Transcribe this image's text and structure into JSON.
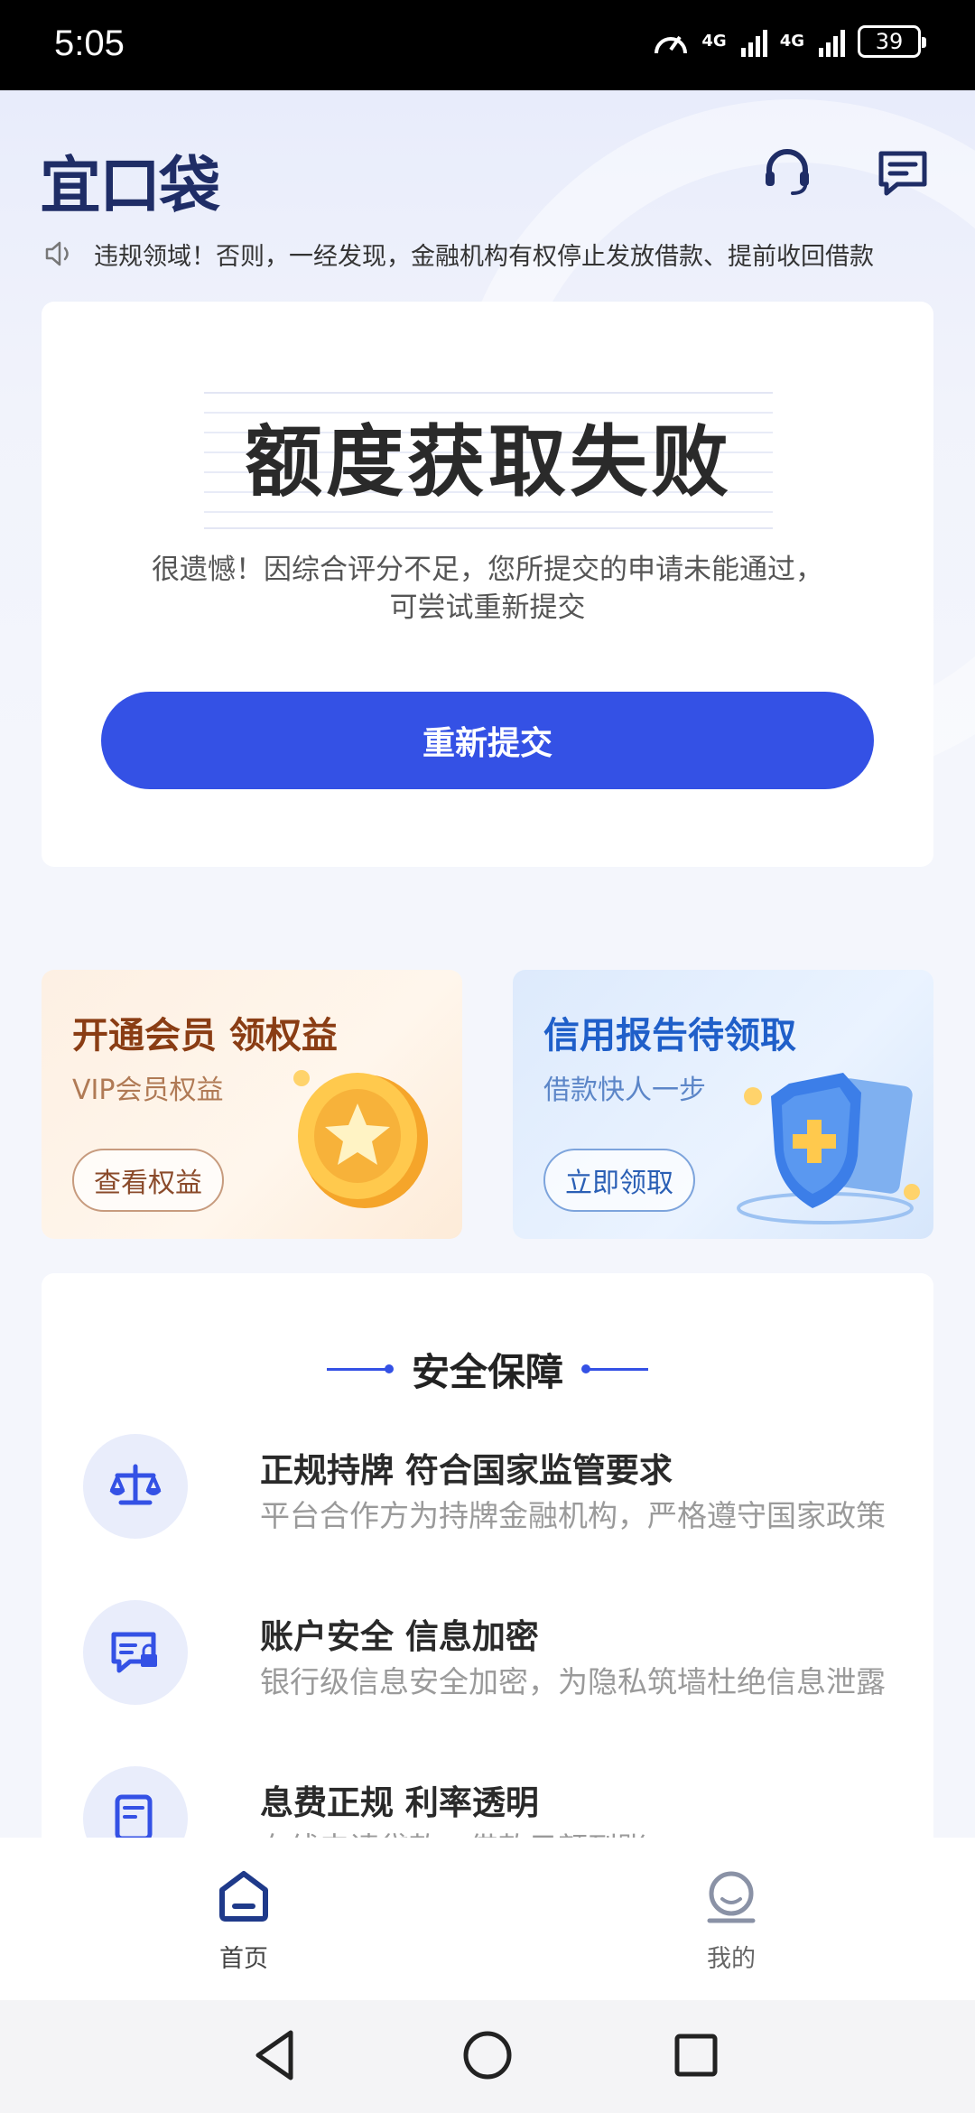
{
  "status_bar": {
    "time": "5:05",
    "network1": "4G",
    "network2": "4G",
    "battery": "39"
  },
  "header": {
    "logo_text": "宜口袋"
  },
  "notice": {
    "text": "违规领域！否则，一经发现，金融机构有权停止发放借款、提前收回借款"
  },
  "result_card": {
    "title": "额度获取失败",
    "description_line1": "很遗憾！因综合评分不足，您所提交的申请未能通过，",
    "description_line2": "可尝试重新提交",
    "button_label": "重新提交"
  },
  "promos": [
    {
      "title": "开通会员 领权益",
      "subtitle": "VIP会员权益",
      "button_label": "查看权益"
    },
    {
      "title": "信用报告待领取",
      "subtitle": "借款快人一步",
      "button_label": "立即领取"
    }
  ],
  "security": {
    "title": "安全保障",
    "items": [
      {
        "title": "正规持牌 符合国家监管要求",
        "desc": "平台合作方为持牌金融机构，严格遵守国家政策"
      },
      {
        "title": "账户安全 信息加密",
        "desc": "银行级信息安全加密，为隐私筑墙杜绝信息泄露"
      },
      {
        "title": "息费正规  利率透明",
        "desc": "在线申请贷款，借款只额到账"
      }
    ]
  },
  "tabbar": {
    "home_label": "首页",
    "mine_label": "我的"
  },
  "colors": {
    "primary": "#3451e5",
    "logo": "#1f2d66"
  }
}
